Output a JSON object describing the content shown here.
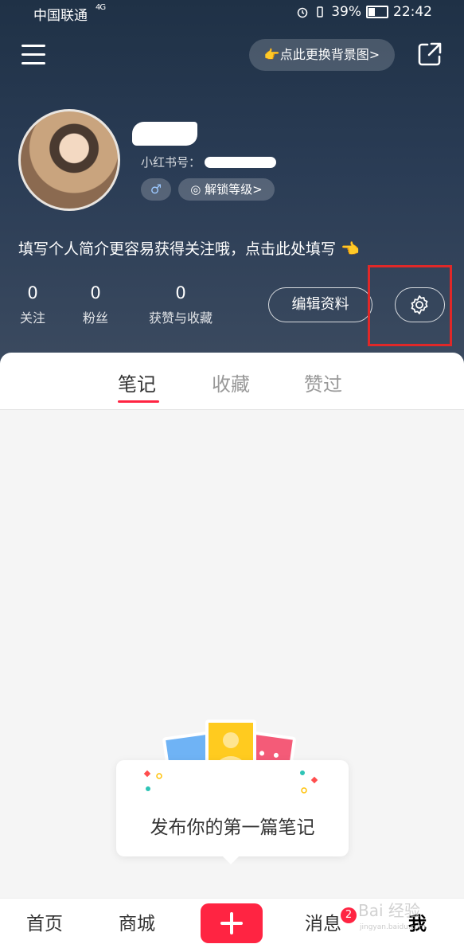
{
  "status_bar": {
    "carrier": "中国联通",
    "network": "4G",
    "battery": "39%",
    "time": "22:42"
  },
  "header": {
    "background_button": "👉点此更换背景图>",
    "redbook_id_label": "小红书号：",
    "gender_symbol": "♂",
    "level_button": "解锁等级>",
    "bio": "填写个人简介更容易获得关注哦，点击此处填写 👈"
  },
  "stats": [
    {
      "value": "0",
      "label": "关注"
    },
    {
      "value": "0",
      "label": "粉丝"
    },
    {
      "value": "0",
      "label": "获赞与收藏"
    }
  ],
  "edit_button": "编辑资料",
  "tabs": [
    "笔记",
    "收藏",
    "赞过"
  ],
  "empty_state": "发布你的第一篇笔记",
  "bottom_nav": {
    "home": "首页",
    "mall": "商城",
    "messages": "消息",
    "messages_badge": "2",
    "me": "我"
  },
  "watermark": {
    "text": "Bai 经验",
    "sub": "jingyan.baidu.com"
  },
  "colors": {
    "accent": "#ff2442",
    "highlight": "#e02828",
    "header_bg": "#2a3c55"
  }
}
